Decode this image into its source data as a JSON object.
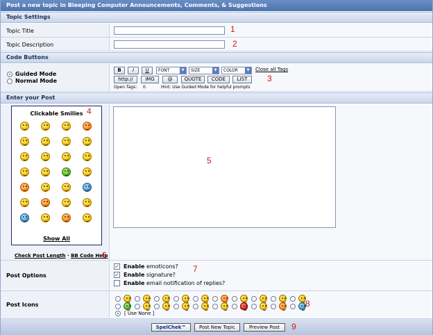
{
  "header": {
    "title": "Post a new topic in Bleeping Computer Announcements, Comments, & Suggestions"
  },
  "topic_settings": {
    "section_title": "Topic Settings",
    "title_label": "Topic Title",
    "description_label": "Topic Description",
    "title_value": "",
    "description_value": ""
  },
  "code_buttons": {
    "section_title": "Code Buttons",
    "mode_guided": "Guided Mode",
    "mode_normal": "Normal Mode",
    "selected_mode": "Guided Mode",
    "bold": "B",
    "italic": "I",
    "underline": "U",
    "font_select": "FONT",
    "size_select": "SIZE",
    "color_select": "COLOR",
    "close_all": "Close all Tags",
    "http": "http://",
    "img": "IMG",
    "at": "@",
    "quote": "QUOTE",
    "code": "CODE",
    "list": "LIST",
    "open_tags_label": "Open Tags:",
    "open_tags_count": "0",
    "hint": "Hint: Use Guided Mode for helpful prompts"
  },
  "post": {
    "section_title": "Enter your Post",
    "smilies_title": "Clickable Smilies",
    "show_all": "Show All",
    "check_length": "Check Post Length",
    "separator": "·",
    "bbcode_help": "BB Code Help",
    "body_value": ""
  },
  "options": {
    "label": "Post Options",
    "enable_word": "Enable",
    "emoticons_text": "emoticons?",
    "signature_text": "signature?",
    "email_text": "email notification of replies?",
    "emoticons_checked": true,
    "signature_checked": true,
    "email_checked": false
  },
  "icons": {
    "label": "Post Icons",
    "use_none": "[ Use None ]"
  },
  "buttons": {
    "spellcheck": "SpelChek™",
    "post_new_topic": "Post New Topic",
    "preview_post": "Preview Post"
  },
  "markers": [
    "1",
    "2",
    "3",
    "4",
    "5",
    "6",
    "7",
    "8",
    "9"
  ]
}
